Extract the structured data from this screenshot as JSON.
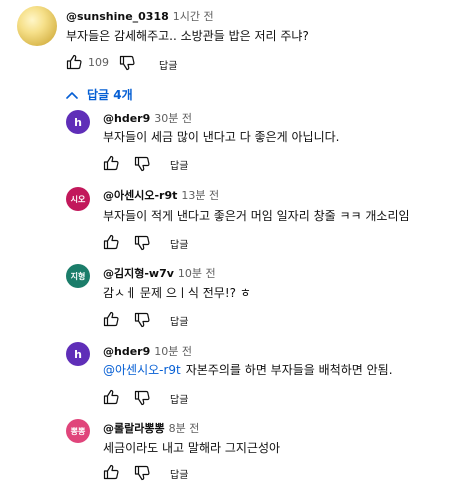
{
  "comment": {
    "author": "@sunshine_0318",
    "time": "1시간 전",
    "text": "부자들은 감세해주고.. 소방관들 밥은 저리 주냐?",
    "likes": "109",
    "reply_label": "답글"
  },
  "replies_toggle": "답글 4개",
  "replies": [
    {
      "avatar_text": "h",
      "avatar_color": "#5f2eb8",
      "author": "@hder9",
      "time": "30분 전",
      "mention": "",
      "text": "부자들이 세금 많이 낸다고 다 좋은게 아닙니다.",
      "reply_label": "답글"
    },
    {
      "avatar_text": "시오",
      "avatar_color": "#c2185b",
      "author": "@아센시오-r9t",
      "time": "13분 전",
      "mention": "",
      "text": "부자들이 적게 낸다고 좋은거 머임 일자리 창줄 ㅋㅋ 개소리임",
      "reply_label": "답글"
    },
    {
      "avatar_text": "지형",
      "avatar_color": "#1b7d6a",
      "author": "@김지형-w7v",
      "time": "10분 전",
      "mention": "",
      "text": "감ㅅㅔ 문제 으ㅣ식 전무!? ㅎ",
      "reply_label": "답글"
    },
    {
      "avatar_text": "h",
      "avatar_color": "#5f2eb8",
      "author": "@hder9",
      "time": "10분 전",
      "mention": "@아센시오-r9t",
      "text": "자본주의를 하면 부자들을 배척하면 안됨.",
      "reply_label": "답글"
    },
    {
      "avatar_text": "뽕뽕",
      "avatar_color": "#e0457b",
      "author": "@롤랄라뽕뽕",
      "time": "8분 전",
      "mention": "",
      "text": "세금이라도 내고 말해라 그지근성아",
      "reply_label": "답글"
    }
  ],
  "icons": {
    "like": "thumbs-up-icon",
    "dislike": "thumbs-down-icon",
    "toggle": "chevron-up-icon"
  },
  "colors": {
    "link": "#065fd4",
    "secondary_text": "#606060"
  }
}
